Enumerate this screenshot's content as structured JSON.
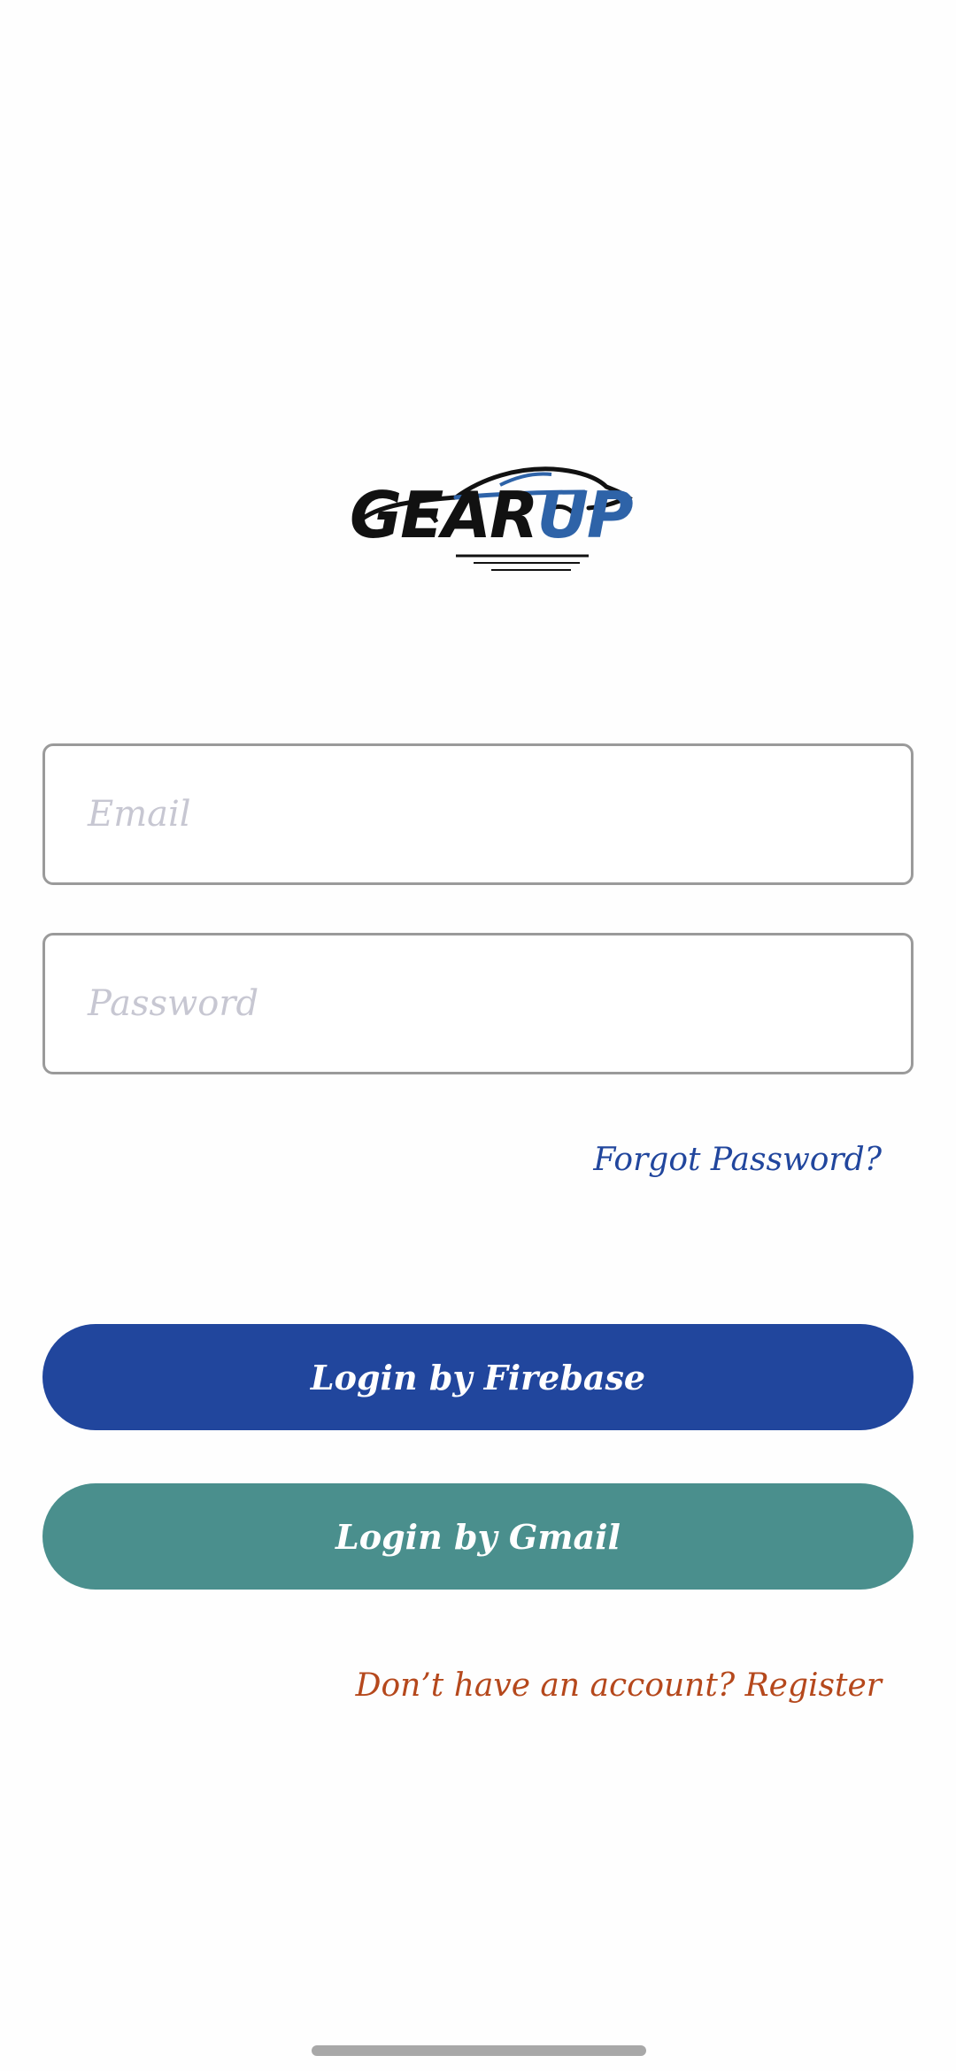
{
  "logo": {
    "word_primary": "GEAR",
    "word_accent": "UP",
    "brand_color": "#2e63a8",
    "icon": "sports-car-icon"
  },
  "form": {
    "email_placeholder": "Email",
    "password_placeholder": "Password",
    "forgot_label": "Forgot Password?"
  },
  "buttons": {
    "firebase_label": "Login by Firebase",
    "gmail_label": "Login by Gmail"
  },
  "footer": {
    "register_label": "Don’t have an account? Register"
  },
  "colors": {
    "primary": "#21469d",
    "secondary": "#4a8f8d",
    "link_register": "#b5481c",
    "border": "#9a9a9a"
  }
}
